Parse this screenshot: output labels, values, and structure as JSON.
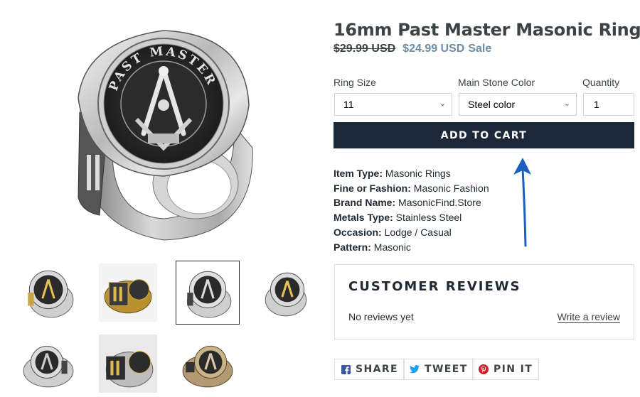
{
  "product": {
    "title": "16mm Past Master Masonic Ring",
    "price_original": "$29.99 USD",
    "price_sale": "$24.99 USD",
    "sale_label": "Sale"
  },
  "options": {
    "ring_size_label": "Ring Size",
    "ring_size_value": "11",
    "stone_color_label": "Main Stone Color",
    "stone_color_value": "Steel color",
    "quantity_label": "Quantity",
    "quantity_value": "1"
  },
  "add_to_cart_label": "ADD TO CART",
  "specs": [
    {
      "key": "Item Type:",
      "value": "Masonic Rings"
    },
    {
      "key": "Fine or Fashion:",
      "value": "Masonic Fashion"
    },
    {
      "key": "Brand Name:",
      "value": "MasonicFind.Store"
    },
    {
      "key": "Metals Type:",
      "value": "Stainless Steel"
    },
    {
      "key": "Occasion:",
      "value": "Lodge / Casual"
    },
    {
      "key": "Pattern:",
      "value": "Masonic"
    }
  ],
  "reviews": {
    "title": "CUSTOMER REVIEWS",
    "empty_text": "No reviews yet",
    "write_link": "Write a review"
  },
  "share": {
    "facebook_label": "SHARE",
    "twitter_label": "TWEET",
    "pinterest_label": "PIN IT"
  },
  "ring_engraving": "PAST MASTER",
  "colors": {
    "button_bg": "#1c2838",
    "sale_price": "#6d8ca5",
    "arrow": "#1b5fc1",
    "facebook": "#3b5998",
    "twitter": "#1da1f2",
    "pinterest": "#cb2027"
  },
  "thumbnails": [
    {
      "name": "thumb-silver-front",
      "tone": "silver"
    },
    {
      "name": "thumb-gold-side",
      "tone": "gold"
    },
    {
      "name": "thumb-silver-angle",
      "tone": "silver",
      "active": true
    },
    {
      "name": "thumb-silver-right",
      "tone": "silver"
    },
    {
      "name": "thumb-silver-tilt",
      "tone": "silver"
    },
    {
      "name": "thumb-silver-gold-inlay",
      "tone": "mixed"
    },
    {
      "name": "thumb-bronze-top",
      "tone": "bronze"
    }
  ]
}
